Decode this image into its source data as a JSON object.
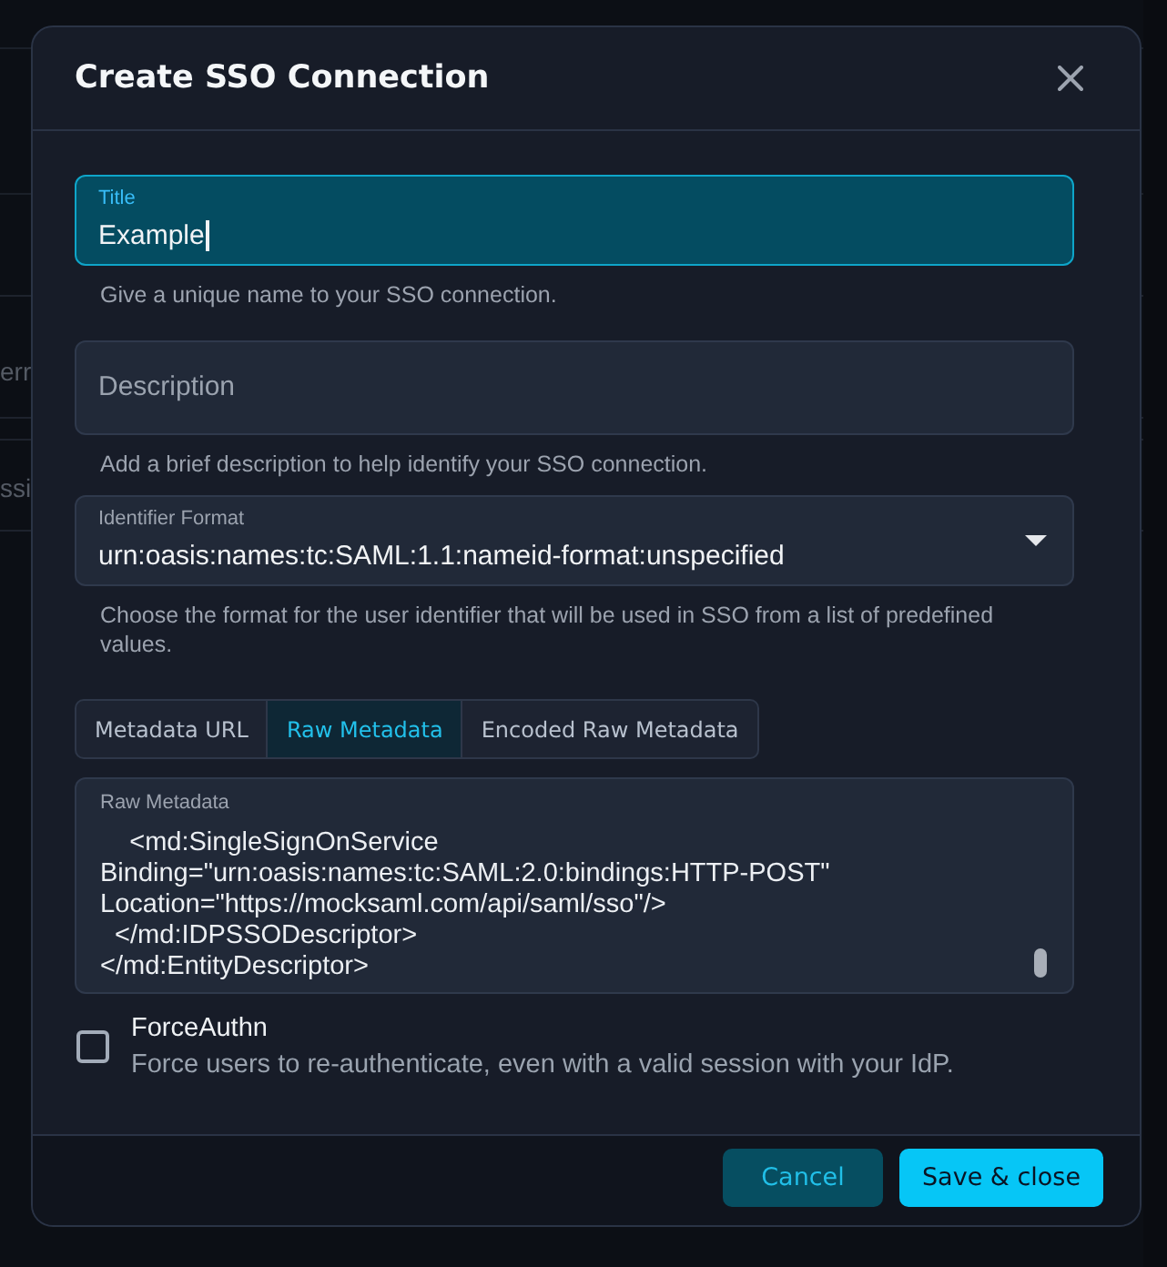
{
  "background": {
    "texts": [
      "err",
      "ssi"
    ]
  },
  "dialog": {
    "title": "Create SSO Connection"
  },
  "fields": [
    {
      "kind": "text",
      "label": "Title",
      "value": "Example",
      "focused": true,
      "helper": "Give a unique name to your SSO connection."
    },
    {
      "kind": "text",
      "placeholder": "Description",
      "focused": false,
      "helper": "Add a brief description to help identify your SSO connection."
    },
    {
      "kind": "select",
      "label": "Identifier Format",
      "value": "urn:oasis:names:tc:SAML:1.1:nameid-format:unspecified",
      "focused": false,
      "helper": "Choose the format for the user identifier that will be used in SSO from a list of predefined values."
    }
  ],
  "metadata_tabs": [
    {
      "label": "Metadata URL",
      "selected": false
    },
    {
      "label": "Raw Metadata",
      "selected": true
    },
    {
      "label": "Encoded Raw Metadata",
      "selected": false
    }
  ],
  "raw_metadata": {
    "label": "Raw Metadata",
    "value": "    <md:SingleSignOnService\nBinding=\"urn:oasis:names:tc:SAML:2.0:bindings:HTTP-POST\"\nLocation=\"https://mocksaml.com/api/saml/sso\"/>\n  </md:IDPSSODescriptor>\n</md:EntityDescriptor>"
  },
  "force_authn": {
    "label": "ForceAuthn",
    "description": "Force users to re-authenticate, even with a valid session with your IdP.",
    "checked": false
  },
  "buttons": [
    {
      "label": "Cancel",
      "kind": "secondary"
    },
    {
      "label": "Save & close",
      "kind": "primary"
    }
  ]
}
